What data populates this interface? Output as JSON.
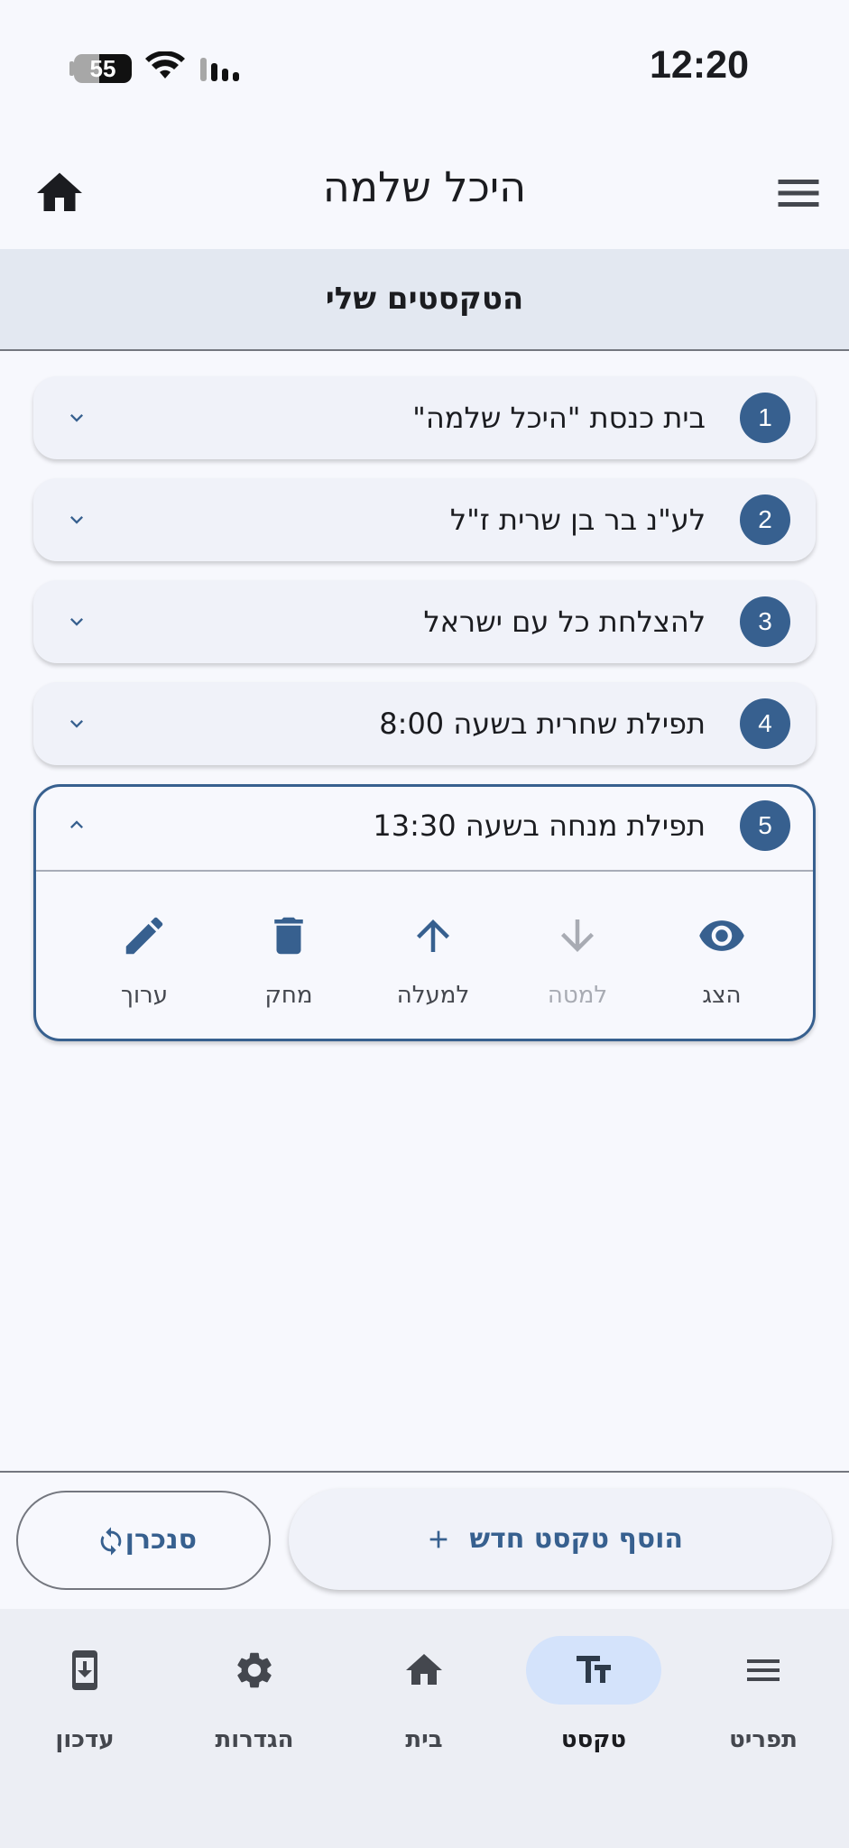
{
  "status": {
    "time": "12:20",
    "battery": "55"
  },
  "appbar": {
    "title": "היכל שלמה",
    "home_icon": "home-icon",
    "menu_icon": "menu-icon"
  },
  "section": {
    "title": "הטקסטים שלי"
  },
  "items": [
    {
      "num": "1",
      "text": "בית כנסת \"היכל שלמה\""
    },
    {
      "num": "2",
      "text": "לע\"נ בר בן שרית ז\"ל"
    },
    {
      "num": "3",
      "text": "להצלחת כל עם ישראל"
    },
    {
      "num": "4",
      "text": "תפילת שחרית בשעה 8:00"
    },
    {
      "num": "5",
      "text": "תפילת מנחה בשעה 13:30",
      "expanded": true
    }
  ],
  "actions": {
    "show": "הצג",
    "down": "למטה",
    "up": "למעלה",
    "delete": "מחק",
    "edit": "ערוך"
  },
  "buttons": {
    "add": "הוסף טקסט חדש",
    "sync": "סנכרן"
  },
  "nav": {
    "menu": "תפריט",
    "text": "טקסט",
    "home": "בית",
    "settings": "הגדרות",
    "update": "עדכון"
  },
  "colors": {
    "primary": "#37608f",
    "background": "#f7f8fd",
    "active_pill": "#d4e3fb"
  }
}
